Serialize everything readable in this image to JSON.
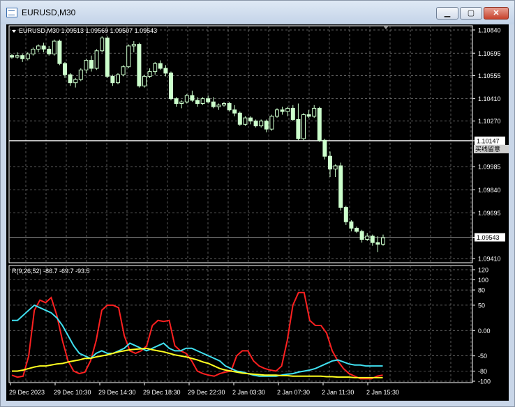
{
  "window": {
    "title": "EURUSD,M30",
    "minimize_glyph": "▁",
    "maximize_glyph": "▢",
    "close_glyph": "✕"
  },
  "colors": {
    "background": "#000000",
    "grid": "#7f7f7f",
    "candle_up": "#ccffcc",
    "candle_down": "#ccffcc",
    "axis_text": "#ffffff",
    "indicator_red": "#ff2020",
    "indicator_cyan": "#40e0f0",
    "indicator_yellow": "#ffff20"
  },
  "price_panel": {
    "header": "EURUSD,M30  1.09513 1.09569 1.09507 1.09543",
    "axis_labels": [
      "1.10840",
      "1.10695",
      "1.10555",
      "1.10410",
      "1.10270",
      "1.10147",
      "1.09985",
      "1.09840",
      "1.09695",
      "1.09543",
      "1.09410"
    ],
    "hline_label": "1.10147",
    "current_price_label": "1.09543",
    "hline_tag": "买线留意",
    "ylim": [
      1.0941,
      1.1084
    ]
  },
  "indicator_panel": {
    "header": "R(9,26,52) -86.7 -69.7 -93.5",
    "axis_labels": [
      "120",
      "100",
      "80",
      "50",
      "0.00",
      "-50",
      "-80",
      "-100"
    ],
    "ylim": [
      -100,
      120
    ]
  },
  "time_axis": [
    "29 Dec 2023",
    "29 Dec 10:30",
    "29 Dec 14:30",
    "29 Dec 18:30",
    "29 Dec 22:30",
    "2 Jan 03:30",
    "2 Jan 07:30",
    "2 Jan 11:30",
    "2 Jan 15:30"
  ],
  "chart_data": [
    {
      "type": "candlestick",
      "candles": [
        [
          1.1068,
          1.1069,
          1.1066,
          1.1067
        ],
        [
          1.1067,
          1.107,
          1.1066,
          1.1068
        ],
        [
          1.1068,
          1.1069,
          1.1064,
          1.1066
        ],
        [
          1.1066,
          1.107,
          1.1065,
          1.1069
        ],
        [
          1.1069,
          1.1073,
          1.1068,
          1.1072
        ],
        [
          1.1072,
          1.1075,
          1.107,
          1.1074
        ],
        [
          1.1074,
          1.1076,
          1.107,
          1.1072
        ],
        [
          1.1072,
          1.1074,
          1.1068,
          1.1069
        ],
        [
          1.1069,
          1.1078,
          1.1068,
          1.1077
        ],
        [
          1.1077,
          1.1078,
          1.1062,
          1.1063
        ],
        [
          1.1063,
          1.1064,
          1.1054,
          1.1056
        ],
        [
          1.1056,
          1.1057,
          1.1049,
          1.1051
        ],
        [
          1.1051,
          1.1054,
          1.1048,
          1.1053
        ],
        [
          1.1053,
          1.106,
          1.1052,
          1.1059
        ],
        [
          1.1059,
          1.1066,
          1.1057,
          1.1065
        ],
        [
          1.1065,
          1.1068,
          1.1058,
          1.106
        ],
        [
          1.106,
          1.1072,
          1.1059,
          1.1071
        ],
        [
          1.1071,
          1.108,
          1.107,
          1.1079
        ],
        [
          1.1079,
          1.108,
          1.1054,
          1.1055
        ],
        [
          1.1055,
          1.1056,
          1.1049,
          1.1051
        ],
        [
          1.1051,
          1.1057,
          1.105,
          1.1056
        ],
        [
          1.1056,
          1.1062,
          1.1055,
          1.1061
        ],
        [
          1.1061,
          1.1075,
          1.106,
          1.1074
        ],
        [
          1.1074,
          1.1077,
          1.107,
          1.1075
        ],
        [
          1.1075,
          1.1076,
          1.1048,
          1.1049
        ],
        [
          1.1049,
          1.1056,
          1.1048,
          1.1055
        ],
        [
          1.1055,
          1.106,
          1.1054,
          1.1058
        ],
        [
          1.1058,
          1.1064,
          1.1056,
          1.1063
        ],
        [
          1.1063,
          1.1065,
          1.1059,
          1.106
        ],
        [
          1.106,
          1.1062,
          1.1055,
          1.1057
        ],
        [
          1.1057,
          1.1058,
          1.104,
          1.1041
        ],
        [
          1.1041,
          1.1042,
          1.1036,
          1.1038
        ],
        [
          1.1038,
          1.104,
          1.1035,
          1.1039
        ],
        [
          1.1039,
          1.1044,
          1.1038,
          1.1043
        ],
        [
          1.1043,
          1.1046,
          1.1039,
          1.104
        ],
        [
          1.104,
          1.1042,
          1.1036,
          1.1038
        ],
        [
          1.1038,
          1.1042,
          1.1037,
          1.1041
        ],
        [
          1.1041,
          1.1043,
          1.1038,
          1.1039
        ],
        [
          1.1039,
          1.1042,
          1.1035,
          1.1036
        ],
        [
          1.1036,
          1.1038,
          1.1034,
          1.1037
        ],
        [
          1.1037,
          1.1039,
          1.1036,
          1.1038
        ],
        [
          1.1038,
          1.1039,
          1.1033,
          1.1034
        ],
        [
          1.1034,
          1.1037,
          1.103,
          1.1032
        ],
        [
          1.1032,
          1.1033,
          1.1024,
          1.1025
        ],
        [
          1.1025,
          1.103,
          1.1024,
          1.1029
        ],
        [
          1.1029,
          1.103,
          1.1025,
          1.1027
        ],
        [
          1.1027,
          1.1028,
          1.1023,
          1.1024
        ],
        [
          1.1024,
          1.1028,
          1.1023,
          1.1027
        ],
        [
          1.1027,
          1.1028,
          1.102,
          1.1022
        ],
        [
          1.1022,
          1.1031,
          1.1021,
          1.103
        ],
        [
          1.103,
          1.1035,
          1.1029,
          1.1034
        ],
        [
          1.1034,
          1.1036,
          1.1031,
          1.1033
        ],
        [
          1.1033,
          1.1036,
          1.103,
          1.1035
        ],
        [
          1.1035,
          1.1037,
          1.1027,
          1.1028
        ],
        [
          1.1028,
          1.1038,
          1.1015,
          1.1016
        ],
        [
          1.1016,
          1.1032,
          1.1015,
          1.1031
        ],
        [
          1.1031,
          1.1034,
          1.1029,
          1.103
        ],
        [
          1.103,
          1.1037,
          1.1029,
          1.1035
        ],
        [
          1.1035,
          1.1036,
          1.1014,
          1.1015
        ],
        [
          1.1015,
          1.1016,
          1.1003,
          1.1005
        ],
        [
          1.1005,
          1.1008,
          1.0992,
          1.0997
        ],
        [
          1.0997,
          1.1,
          1.0992,
          1.0999
        ],
        [
          1.0999,
          1.1001,
          1.0971,
          1.0973
        ],
        [
          1.0973,
          1.0974,
          1.0962,
          1.0964
        ],
        [
          1.0964,
          1.0965,
          1.0958,
          1.096
        ],
        [
          1.096,
          1.0961,
          1.0957,
          1.0958
        ],
        [
          1.0958,
          1.0959,
          1.0951,
          1.0953
        ],
        [
          1.0953,
          1.0957,
          1.0952,
          1.0955
        ],
        [
          1.0955,
          1.0956,
          1.0949,
          1.0951
        ],
        [
          1.0951,
          1.0955,
          1.0945,
          1.095
        ],
        [
          1.095,
          1.0956,
          1.0949,
          1.0954
        ]
      ]
    },
    {
      "type": "line",
      "series": [
        {
          "values": [
            -88,
            -92,
            -90,
            -50,
            40,
            60,
            55,
            65,
            30,
            -20,
            -60,
            -80,
            -85,
            -82,
            -60,
            -20,
            40,
            50,
            50,
            45,
            -10,
            -40,
            -45,
            -40,
            -30,
            10,
            20,
            18,
            20,
            -30,
            -40,
            -45,
            -60,
            -80,
            -85,
            -88,
            -90,
            -85,
            -82,
            -80,
            -50,
            -40,
            -40,
            -60,
            -70,
            -75,
            -78,
            -80,
            -70,
            -20,
            50,
            75,
            75,
            20,
            10,
            10,
            -5,
            -40,
            -60,
            -75,
            -85,
            -90,
            -95,
            -95,
            -95,
            -90,
            -88
          ]
        },
        {
          "values": [
            20,
            20,
            30,
            40,
            50,
            45,
            40,
            35,
            25,
            10,
            -10,
            -30,
            -45,
            -50,
            -55,
            -45,
            -40,
            -45,
            -45,
            -40,
            -35,
            -25,
            -30,
            -35,
            -40,
            -35,
            -30,
            -25,
            -35,
            -40,
            -40,
            -35,
            -35,
            -40,
            -45,
            -50,
            -55,
            -60,
            -70,
            -75,
            -80,
            -82,
            -85,
            -88,
            -90,
            -90,
            -90,
            -90,
            -88,
            -86,
            -85,
            -82,
            -80,
            -78,
            -75,
            -70,
            -65,
            -60,
            -58,
            -62,
            -66,
            -68,
            -68,
            -70,
            -70,
            -70,
            -70
          ]
        },
        {
          "values": [
            -80,
            -80,
            -78,
            -75,
            -72,
            -70,
            -70,
            -68,
            -66,
            -65,
            -62,
            -60,
            -58,
            -55,
            -55,
            -52,
            -50,
            -48,
            -45,
            -42,
            -40,
            -38,
            -37,
            -36,
            -35,
            -38,
            -40,
            -42,
            -45,
            -48,
            -50,
            -52,
            -55,
            -58,
            -62,
            -65,
            -70,
            -75,
            -78,
            -80,
            -82,
            -84,
            -85,
            -86,
            -87,
            -88,
            -88,
            -88,
            -89,
            -89,
            -90,
            -90,
            -90,
            -90,
            -90,
            -90,
            -91,
            -91,
            -92,
            -92,
            -92,
            -93,
            -93,
            -93,
            -93,
            -93,
            -93
          ]
        }
      ],
      "ylim": [
        -100,
        120
      ]
    }
  ]
}
